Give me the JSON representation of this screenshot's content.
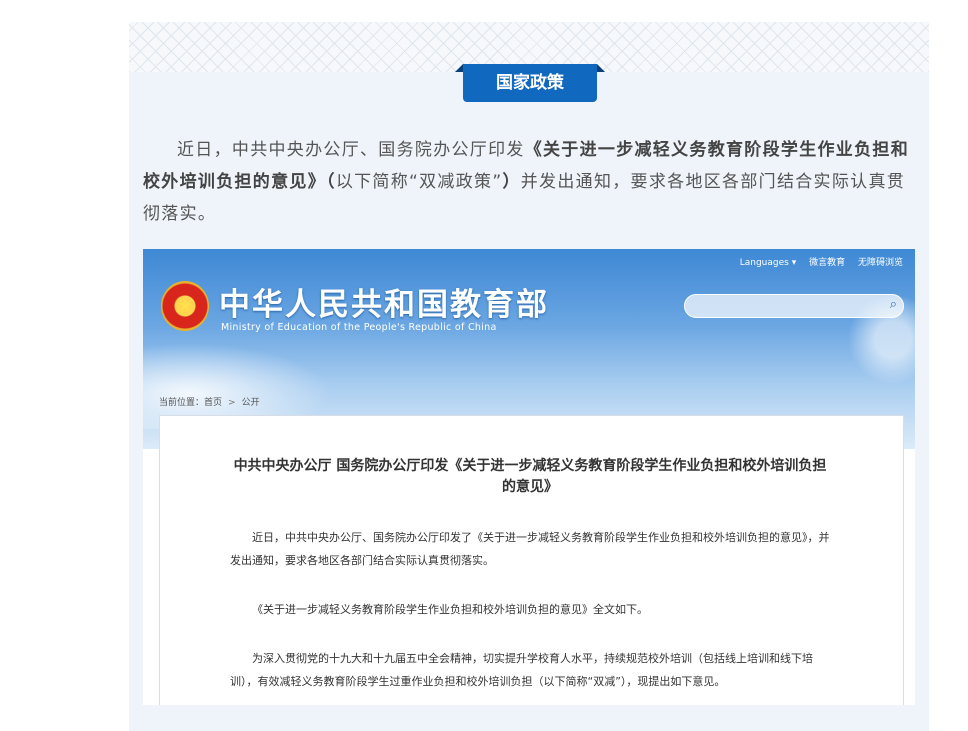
{
  "section_tag": "国家政策",
  "intro": {
    "prefix": "近日，中共中央办公厅、国务院办公厅印发",
    "bold": "《关于进一步减轻义务教育阶段学生作业负担和校外培训负担的意见》（",
    "middle": "以下简称“双减政策”",
    "bold2": "）",
    "suffix": "并发出通知，要求各地区各部门结合实际认真贯彻落实。"
  },
  "moe": {
    "topbar": {
      "languages": "Languages ▾",
      "weibo": "微言教育",
      "accessibility": "无障碍浏览"
    },
    "title": "中华人民共和国教育部",
    "subtitle": "Ministry of Education of the People's Republic of China",
    "breadcrumb": {
      "prefix": "当前位置：",
      "home": "首页",
      "sep": ">",
      "current": "公开"
    },
    "article": {
      "title": "中共中央办公厅 国务院办公厅印发《关于进一步减轻义务教育阶段学生作业负担和校外培训负担的意见》",
      "p1": "近日，中共中央办公厅、国务院办公厅印发了《关于进一步减轻义务教育阶段学生作业负担和校外培训负担的意见》，并发出通知，要求各地区各部门结合实际认真贯彻落实。",
      "p2": "《关于进一步减轻义务教育阶段学生作业负担和校外培训负担的意见》全文如下。",
      "p3": "为深入贯彻党的十九大和十九届五中全会精神，切实提升学校育人水平，持续规范校外培训（包括线上培训和线下培训），有效减轻义务教育阶段学生过重作业负担和校外培训负担（以下简称“双减”），现提出如下意见。"
    }
  }
}
